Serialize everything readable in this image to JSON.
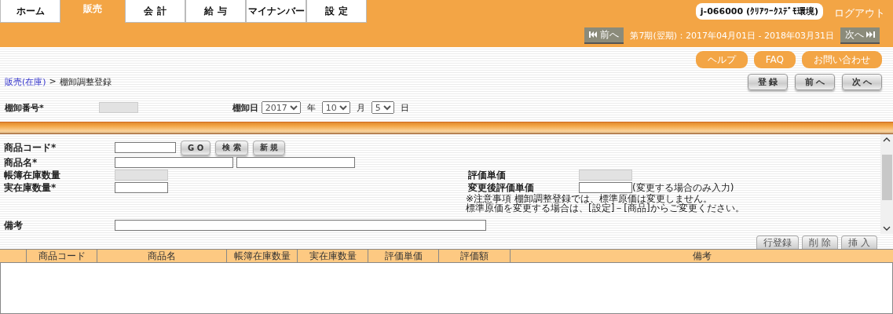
{
  "tabs": [
    {
      "label": "ホーム",
      "selected": false
    },
    {
      "label": "販売",
      "selected": true
    },
    {
      "label": "会 計",
      "selected": false
    },
    {
      "label": "給 与",
      "selected": false
    },
    {
      "label": "マイナンバー",
      "selected": false
    },
    {
      "label": "設 定",
      "selected": false
    }
  ],
  "user": {
    "account": "j-066000 (ｸﾘｱﾜｰｸｽﾃﾞﾓ環境)",
    "logout": "ログアウト"
  },
  "period": {
    "prev": "前へ",
    "label": "第7期(翌期)：2017年04月01日 - 2018年03月31日",
    "next": "次へ"
  },
  "help_links": [
    "ヘルプ",
    "FAQ",
    "お問い合わせ"
  ],
  "breadcrumb": {
    "link": "販売(在庫)",
    "separator": ">",
    "current": "棚卸調整登録"
  },
  "actions": [
    "登 録",
    "前 へ",
    "次 へ"
  ],
  "header_fields": {
    "number_label": "棚卸番号*",
    "number_disabled": true,
    "date_label": "棚卸日",
    "year": "2017",
    "year_unit": "年",
    "month": "10",
    "month_unit": "月",
    "day": "5",
    "day_unit": "日"
  },
  "product_form": {
    "rows": [
      {
        "kind": "code",
        "label": "商品コード*",
        "buttons": [
          "G O",
          "検 索",
          "新 規"
        ]
      },
      {
        "kind": "name",
        "label": "商品名*"
      },
      {
        "kind": "qty",
        "label": "帳簿在庫数量",
        "disabled": true,
        "right": {
          "label": "評価単価",
          "disabled": true
        }
      },
      {
        "kind": "qty",
        "label": "実在庫数量*",
        "disabled": false,
        "right": {
          "label": "変更後評価単価",
          "disabled": false,
          "hint": "(変更する場合のみ入力)"
        }
      }
    ],
    "notes": [
      "※注意事項  棚卸調整登録では、標準原価は変更しません。",
      "標準原価を変更する場合は、[設定]－[商品]からご変更ください。"
    ],
    "remarks_label": "備考"
  },
  "row_buttons": [
    "行登録",
    "削 除",
    "挿 入"
  ],
  "table": {
    "columns": [
      "商品コード",
      "商品名",
      "帳簿在庫数量",
      "実在庫数量",
      "評価単価",
      "評価額",
      "備考"
    ]
  }
}
